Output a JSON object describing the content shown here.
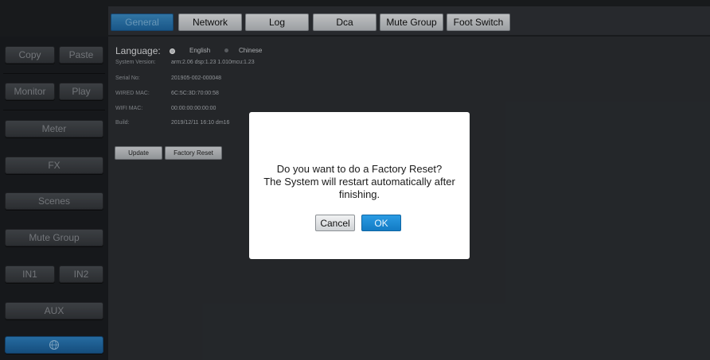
{
  "tabs": [
    {
      "label": "General",
      "active": true
    },
    {
      "label": "Network",
      "active": false
    },
    {
      "label": "Log",
      "active": false
    },
    {
      "label": "Dca",
      "active": false
    },
    {
      "label": "Mute Group",
      "active": false
    },
    {
      "label": "Foot Switch",
      "active": false
    }
  ],
  "sidebar": {
    "copy": "Copy",
    "paste": "Paste",
    "monitor": "Monitor",
    "play": "Play",
    "meter": "Meter",
    "fx": "FX",
    "scenes": "Scenes",
    "mute_group": "Mute Group",
    "in1": "IN1",
    "in2": "IN2",
    "aux": "AUX",
    "bottom_icon": "globe-icon"
  },
  "general": {
    "language_label": "Language:",
    "language_options": [
      "English",
      "Chinese"
    ],
    "language_selected": "English",
    "system_version_label": "System Version:",
    "system_version": "arm:2.06 dsp:1.23 1.010mcu:1.23",
    "serial_label": "Serial No:",
    "serial": "201905-002-000048",
    "wired_mac_label": "WIRED MAC:",
    "wired_mac": "6C:5C:3D:70:00:58",
    "wifi_mac_label": "WIFI MAC:",
    "wifi_mac": "00:00:00:00:00:00",
    "build_label": "Build:",
    "build": "2019/12/11 16:10 dm16",
    "update_button": "Update",
    "factory_reset_button": "Factory Reset"
  },
  "dialog": {
    "line1": "Do you want to do a Factory Reset?",
    "line2": "The System will restart automatically after",
    "line3": "finishing.",
    "cancel": "Cancel",
    "ok": "OK"
  },
  "colors": {
    "accent": "#1f6aa6",
    "sidebar_bg": "#1c1e21",
    "content_bg": "#2c2f33"
  }
}
